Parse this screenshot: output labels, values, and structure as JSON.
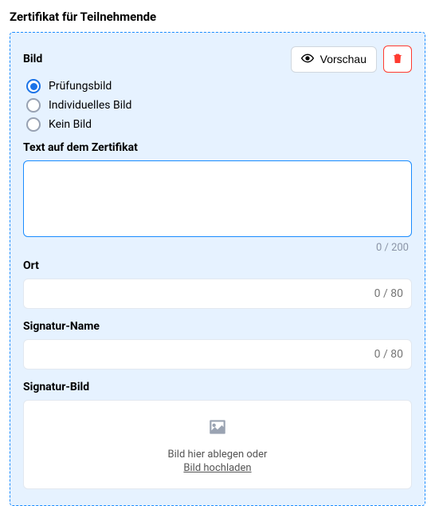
{
  "section_title": "Zertifikat für Teilnehmende",
  "bild": {
    "label": "Bild",
    "options": [
      {
        "label": "Prüfungsbild",
        "selected": true
      },
      {
        "label": "Individuelles Bild",
        "selected": false
      },
      {
        "label": "Kein Bild",
        "selected": false
      }
    ]
  },
  "actions": {
    "preview_label": "Vorschau"
  },
  "text_cert": {
    "label": "Text auf dem Zertifikat",
    "value": "",
    "counter": "0 / 200"
  },
  "ort": {
    "label": "Ort",
    "value": "",
    "counter": "0 / 80"
  },
  "sig_name": {
    "label": "Signatur-Name",
    "value": "",
    "counter": "0 / 80"
  },
  "sig_bild": {
    "label": "Signatur-Bild",
    "drop_text": "Bild hier ablegen oder",
    "upload_link": "Bild hochladen"
  }
}
